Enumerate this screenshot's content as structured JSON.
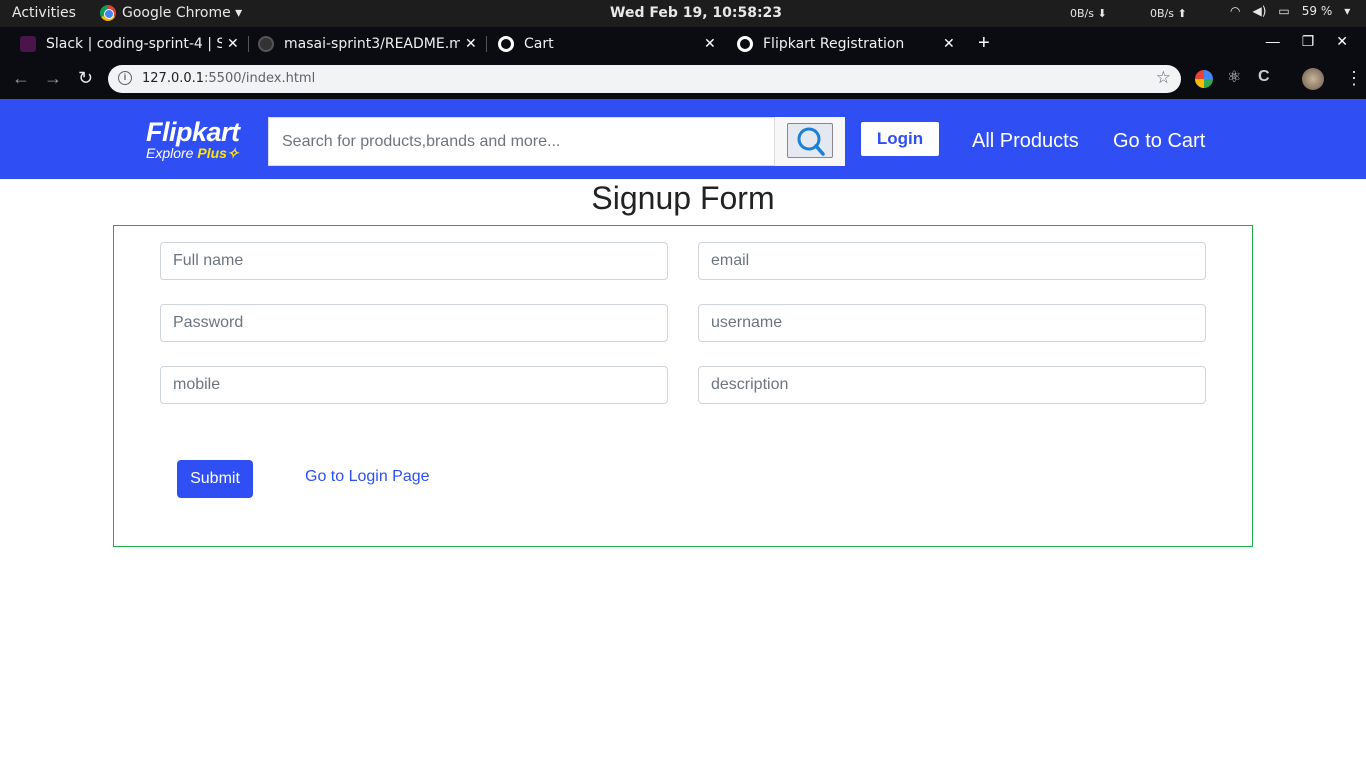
{
  "system_bar": {
    "activities": "Activities",
    "app_name": "Google Chrome ▾",
    "clock": "Wed Feb 19, 10:58:23",
    "net_down": "0B/s ⬇",
    "net_up": "0B/s ⬆",
    "battery": "59 %"
  },
  "tabs": [
    {
      "label": "Slack | coding-sprint-4 | Sa",
      "icon": "slack-icon"
    },
    {
      "label": "masai-sprint3/README.m",
      "icon": "github-icon"
    },
    {
      "label": "Cart",
      "icon": "globe-icon"
    },
    {
      "label": "Flipkart Registration",
      "icon": "globe-icon",
      "active": true
    }
  ],
  "address_bar": {
    "host": "127.0.0.1",
    "path": ":5500/index.html"
  },
  "header": {
    "logo": "Flipkart",
    "logo_tag": "Explore",
    "logo_tag_plus": "Plus",
    "search_placeholder": "Search for products,brands and more...",
    "login_label": "Login",
    "all_products": "All Products",
    "go_to_cart": "Go to Cart",
    "brand_color": "#2f4ff5"
  },
  "form": {
    "title": "Signup Form",
    "fields": {
      "full_name": "Full name",
      "email": "email",
      "password": "Password",
      "username": "username",
      "mobile": "mobile",
      "description": "description"
    },
    "submit": "Submit",
    "login_link": "Go to Login Page",
    "border_color": "#1cae4c"
  }
}
